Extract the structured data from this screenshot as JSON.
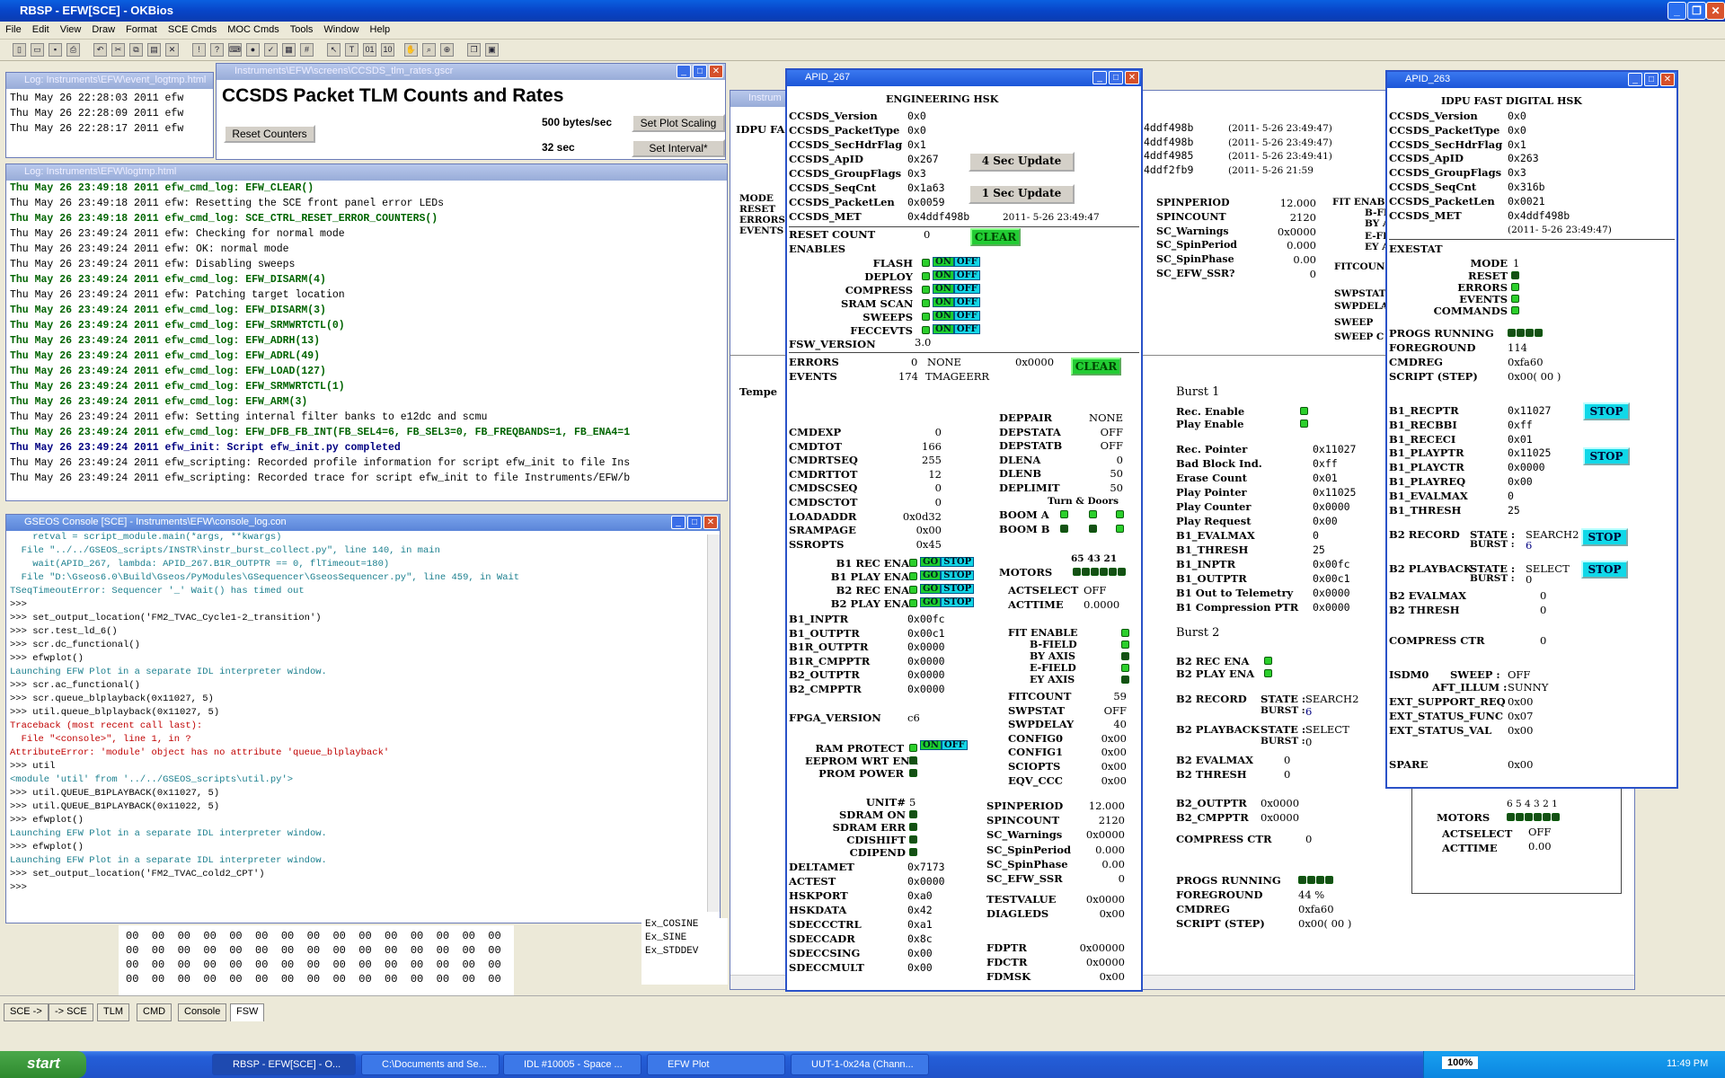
{
  "app": {
    "title": "RBSP - EFW[SCE] - OKBios"
  },
  "menu": [
    "File",
    "Edit",
    "View",
    "Draw",
    "Format",
    "SCE Cmds",
    "MOC Cmds",
    "Tools",
    "Window",
    "Help"
  ],
  "eventlog": {
    "title": "Log: Instruments\\EFW\\event_logtmp.html",
    "lines": [
      "Thu May 26 22:28:03 2011 efw",
      "Thu May 26 22:28:09 2011 efw",
      "Thu May 26 22:28:17 2011 efw"
    ]
  },
  "rates": {
    "title": "Instruments\\EFW\\screens\\CCSDS_tlm_rates.gscr",
    "heading": "CCSDS Packet TLM Counts and Rates",
    "reset": "Reset Counters",
    "rate": "500 bytes/sec",
    "interval": "32 sec",
    "scaling": "Set Plot Scaling",
    "setint": "Set Interval*"
  },
  "logtmp": {
    "title": "Log: Instruments\\EFW\\logtmp.html",
    "lines": [
      [
        "g",
        "Thu May 26 23:49:18 2011 efw_cmd_log: EFW_CLEAR()"
      ],
      [
        "n",
        "Thu May 26 23:49:18 2011 efw: Resetting the SCE front panel error LEDs"
      ],
      [
        "g",
        "Thu May 26 23:49:18 2011 efw_cmd_log: SCE_CTRL_RESET_ERROR_COUNTERS()"
      ],
      [
        "n",
        "Thu May 26 23:49:24 2011 efw: Checking for normal mode"
      ],
      [
        "n",
        "Thu May 26 23:49:24 2011 efw: OK: normal mode"
      ],
      [
        "n",
        "Thu May 26 23:49:24 2011 efw: Disabling sweeps"
      ],
      [
        "g",
        "Thu May 26 23:49:24 2011 efw_cmd_log: EFW_DISARM(4)"
      ],
      [
        "n",
        "Thu May 26 23:49:24 2011 efw: Patching target location"
      ],
      [
        "g",
        "Thu May 26 23:49:24 2011 efw_cmd_log: EFW_DISARM(3)"
      ],
      [
        "g",
        "Thu May 26 23:49:24 2011 efw_cmd_log: EFW_SRMWRTCTL(0)"
      ],
      [
        "g",
        "Thu May 26 23:49:24 2011 efw_cmd_log: EFW_ADRH(13)"
      ],
      [
        "g",
        "Thu May 26 23:49:24 2011 efw_cmd_log: EFW_ADRL(49)"
      ],
      [
        "g",
        "Thu May 26 23:49:24 2011 efw_cmd_log: EFW_LOAD(127)"
      ],
      [
        "g",
        "Thu May 26 23:49:24 2011 efw_cmd_log: EFW_SRMWRTCTL(1)"
      ],
      [
        "g",
        "Thu May 26 23:49:24 2011 efw_cmd_log: EFW_ARM(3)"
      ],
      [
        "n",
        "Thu May 26 23:49:24 2011 efw: Setting internal filter banks to e12dc and scmu"
      ],
      [
        "g",
        "Thu May 26 23:49:24 2011 efw_cmd_log: EFW_DFB_FB_INT(FB_SEL4=6, FB_SEL3=0, FB_FREQBANDS=1, FB_ENA4=1"
      ],
      [
        "b",
        "Thu May 26 23:49:24 2011 efw_init: Script efw_init.py completed"
      ],
      [
        "n",
        "Thu May 26 23:49:24 2011 efw_scripting: Recorded profile information for script efw_init to file Ins"
      ],
      [
        "n",
        "Thu May 26 23:49:24 2011 efw_scripting: Recorded trace for script efw_init to file Instruments/EFW/b"
      ]
    ]
  },
  "console": {
    "title": "GSEOS Console  [SCE] - Instruments\\EFW\\console_log.con",
    "lines": [
      [
        "t",
        "    retval = script_module.main(*args, **kwargs)"
      ],
      [
        "t",
        "  File \"../../GSEOS_scripts/INSTR\\instr_burst_collect.py\", line 140, in main"
      ],
      [
        "t",
        "    wait(APID_267, lambda: APID_267.B1R_OUTPTR == 0, flTimeout=180)"
      ],
      [
        "t",
        "  File \"D:\\Gseos6.0\\Build\\Gseos/PyModules\\GSequencer\\GseosSequencer.py\", line 459, in Wait"
      ],
      [
        "t",
        "TSeqTimeoutError: Sequencer '_' Wait() has timed out"
      ],
      [
        "k",
        ">>>"
      ],
      [
        "k",
        ">>> set_output_location('FM2_TVAC_Cycle1-2_transition')"
      ],
      [
        "k",
        ">>> scr.test_ld_6()"
      ],
      [
        "k",
        ">>> scr.dc_functional()"
      ],
      [
        "k",
        ">>> efwplot()"
      ],
      [
        "t",
        "Launching EFW Plot in a separate IDL interpreter window."
      ],
      [
        "k",
        ">>> scr.ac_functional()"
      ],
      [
        "k",
        ">>> scr.queue_blplayback(0x11027, 5)"
      ],
      [
        "k",
        ">>> util.queue_blplayback(0x11027, 5)"
      ],
      [
        "r",
        "Traceback (most recent call last):"
      ],
      [
        "r",
        "  File \"<console>\", line 1, in ?"
      ],
      [
        "r",
        "AttributeError: 'module' object has no attribute 'queue_blplayback'"
      ],
      [
        "k",
        ">>> util"
      ],
      [
        "t",
        "<module 'util' from '../../GSEOS_scripts\\util.py'>"
      ],
      [
        "k",
        ">>> util.QUEUE_B1PLAYBACK(0x11027, 5)"
      ],
      [
        "k",
        ">>> util.QUEUE_B1PLAYBACK(0x11022, 5)"
      ],
      [
        "k",
        ">>> efwplot()"
      ],
      [
        "t",
        "Launching EFW Plot in a separate IDL interpreter window."
      ],
      [
        "k",
        ">>> efwplot()"
      ],
      [
        "t",
        "Launching EFW Plot in a separate IDL interpreter window."
      ],
      [
        "k",
        ">>> set_output_location('FM2_TVAC_cold2_CPT')"
      ],
      [
        "k",
        ">>>"
      ]
    ]
  },
  "hexgrid": [
    "00  00  00  00  00  00  00  00  00  00  00  00  00  00  00  00",
    "00  00  00  00  00  00  00  00  00  00  00  00  00  00  00  00",
    "00  00  00  00  00  00  00  00  00  00  00  00  00  00  00  00",
    "00  00  00  00  00  00  00  00  00  00  00  00  00  00  00  00"
  ],
  "exlist": [
    "Ex_COSINE",
    "Ex_SINE",
    "Ex_STDDEV"
  ],
  "bg": {
    "title": "Instrum",
    "idpu": "IDPU FA",
    "mode": "MODE",
    "reset": "RESET",
    "errors": "ERRORS",
    "events": "EVENTS",
    "temp": "Tempe",
    "met": [
      [
        "4ddf498b",
        "(2011- 5-26  23:49:47)"
      ],
      [
        "4ddf498b",
        "(2011- 5-26  23:49:47)"
      ],
      [
        "4ddf4985",
        "(2011- 5-26  23:49:41)"
      ],
      [
        "4ddf2fb9",
        "(2011- 5-26  21:59"
      ]
    ],
    "spin": [
      [
        "SPINPERIOD",
        "12.000"
      ],
      [
        "SPINCOUNT",
        "2120"
      ],
      [
        "SC_Warnings",
        "0x0000"
      ],
      [
        "SC_SpinPeriod",
        "0.000"
      ],
      [
        "SC_SpinPhase",
        "0.00"
      ],
      [
        "SC_EFW_SSR?",
        "0"
      ]
    ],
    "fitlabels": [
      "FIT ENAB",
      "B-FI",
      "BY A",
      "E-FI",
      "EY A",
      "FITCOUN",
      "SWPSTAT",
      "SWPDELA",
      "SWEEP",
      "SWEEP C"
    ],
    "burst1": {
      "title": "Burst 1",
      "recena": "Rec. Enable",
      "playena": "Play Enable",
      "rows": [
        [
          "Rec. Pointer",
          "0x11027"
        ],
        [
          "Bad Block Ind.",
          "0xff"
        ],
        [
          "Erase Count",
          "0x01"
        ],
        [
          "Play Pointer",
          "0x11025"
        ],
        [
          "Play Counter",
          "0x0000"
        ],
        [
          "Play Request",
          "0x00"
        ],
        [
          "B1_EVALMAX",
          "0"
        ],
        [
          "B1_THRESH",
          "25"
        ],
        [
          "B1_INPTR",
          "0x00fc"
        ],
        [
          "B1_OUTPTR",
          "0x00c1"
        ],
        [
          "B1 Out to Telemetry",
          "0x0000"
        ],
        [
          "B1 Compression PTR",
          "0x0000"
        ]
      ]
    },
    "burst2": {
      "title": "Burst 2",
      "recena": "B2 REC ENA",
      "playena": "B2 PLAY ENA",
      "record": "B2 RECORD",
      "playback": "B2 PLAYBACK",
      "state": "STATE :",
      "burst": "BURST :",
      "rstate": "SEARCH2",
      "rburst": "6",
      "pstate": "SELECT",
      "pburst": "0",
      "evalmax": "B2 EVALMAX",
      "thresh": "B2 THRESH",
      "evalv": "0",
      "threshv": "0",
      "outptr": "B2_OUTPTR",
      "cmpptr": "B2_CMPPTR",
      "outv": "0x0000",
      "cmpv": "0x0000",
      "compress": "COMPRESS CTR",
      "compv": "0"
    },
    "progs": {
      "running": "PROGS RUNNING",
      "foreground": "FOREGROUND",
      "fgv": "44 %",
      "cmdreg": "CMDREG",
      "cmdv": "0xfa60",
      "script": "SCRIPT (STEP)",
      "scriptv": "0x00( 00 )"
    },
    "motors": {
      "nums": "6 5 4 3 2 1",
      "label": "MOTORS",
      "actselect": "ACTSELECT",
      "actselv": "OFF",
      "acttime": "ACTTIME",
      "acttimev": "0.00"
    }
  },
  "apid267": {
    "title": "APID_267",
    "heading": "ENGINEERING HSK",
    "ccsds": [
      [
        "CCSDS_Version",
        "0x0"
      ],
      [
        "CCSDS_PacketType",
        "0x0"
      ],
      [
        "CCSDS_SecHdrFlag",
        "0x1"
      ],
      [
        "CCSDS_ApID",
        "0x267"
      ],
      [
        "CCSDS_GroupFlags",
        "0x3"
      ],
      [
        "CCSDS_SeqCnt",
        "0x1a63"
      ],
      [
        "CCSDS_PacketLen",
        "0x0059"
      ],
      [
        "CCSDS_MET",
        "0x4ddf498b"
      ]
    ],
    "upd4": "4 Sec Update",
    "upd1": "1 Sec Update",
    "metdate": "2011- 5-26  23:49:47",
    "resetcount": "RESET COUNT",
    "resetv": "0",
    "clear": "CLEAR",
    "enables": "ENABLES",
    "enablist": [
      "FLASH",
      "DEPLOY",
      "COMPRESS",
      "SRAM SCAN",
      "SWEEPS",
      "FECCEVTS"
    ],
    "on": "ON",
    "off": "OFF",
    "fswv": "FSW_VERSION",
    "fswvv": "3.0",
    "errors": "ERRORS",
    "errv": "0",
    "errname": "NONE",
    "errhex": "0x0000",
    "events": "EVENTS",
    "evv": "174",
    "evname": "TMAGEERR",
    "left": [
      [
        "CMDEXP",
        "0"
      ],
      [
        "CMDTOT",
        "166"
      ],
      [
        "CMDRTSEQ",
        "255"
      ],
      [
        "CMDRTTOT",
        "12"
      ],
      [
        "CMDSCSEQ",
        "0"
      ],
      [
        "CMDSCTOT",
        "0"
      ],
      [
        "LOADADDR",
        "0x0d32"
      ],
      [
        "SRAMPAGE",
        "0x00"
      ],
      [
        "SSROPTS",
        "0x45"
      ]
    ],
    "deppair": [
      [
        "DEPPAIR",
        "NONE"
      ],
      [
        "DEPSTATA",
        "OFF"
      ],
      [
        "DEPSTATB",
        "OFF"
      ],
      [
        "DLENA",
        "0"
      ],
      [
        "DLENB",
        "50"
      ],
      [
        "DEPLIMIT",
        "50"
      ]
    ],
    "turndoors": "Turn & Doors",
    "booma": "BOOM A",
    "boomb": "BOOM B",
    "recplay": [
      "B1 REC ENA",
      "B1 PLAY ENA",
      "B2 REC ENA",
      "B2 PLAY ENA"
    ],
    "go": "GO",
    "stop": "STOP",
    "motors": "MOTORS",
    "motornums": "65 43 21",
    "actselect": "ACTSELECT",
    "actselv": "OFF",
    "acttime": "ACTTIME",
    "acttimev": "0.0000",
    "ptrs": [
      [
        "B1_INPTR",
        "0x00fc"
      ],
      [
        "B1_OUTPTR",
        "0x00c1"
      ],
      [
        "B1R_OUTPTR",
        "0x0000"
      ],
      [
        "B1R_CMPPTR",
        "0x0000"
      ],
      [
        "B2_OUTPTR",
        "0x0000"
      ],
      [
        "B2_CMPPTR",
        "0x0000"
      ]
    ],
    "fit": [
      "FIT ENABLE",
      "B-FIELD",
      "BY AXIS",
      "E-FIELD",
      "EY AXIS"
    ],
    "fitcount": [
      [
        "FITCOUNT",
        "59"
      ],
      [
        "SWPSTAT",
        "OFF"
      ],
      [
        "SWPDELAY",
        "40"
      ],
      [
        "CONFIG0",
        "0x00"
      ],
      [
        "CONFIG1",
        "0x00"
      ],
      [
        "SCIOPTS",
        "0x00"
      ],
      [
        "EQV_CCC",
        "0x00"
      ]
    ],
    "fpga": "FPGA_VERSION",
    "fpgav": "c6",
    "ramprot": "RAM PROTECT",
    "eeprom": "EEPROM WRT ENA",
    "prompow": "PROM POWER",
    "unit": "UNIT#",
    "unitv": "5",
    "sdram": [
      "SDRAM ON",
      "SDRAM ERR",
      "CDISHIFT",
      "CDIPEND"
    ],
    "spin": [
      [
        "SPINPERIOD",
        "12.000"
      ],
      [
        "SPINCOUNT",
        "2120"
      ],
      [
        "SC_Warnings",
        "0x0000"
      ],
      [
        "SC_SpinPeriod",
        "0.000"
      ],
      [
        "SC_SpinPhase",
        "0.00"
      ],
      [
        "SC_EFW_SSR",
        "0"
      ]
    ],
    "bottom": [
      [
        "DELTAMET",
        "0x7173"
      ],
      [
        "ACTEST",
        "0x0000"
      ],
      [
        "HSKPORT",
        "0xa0"
      ],
      [
        "HSKDATA",
        "0x42"
      ],
      [
        "SDECCCTRL",
        "0xa1"
      ],
      [
        "SDECCADR",
        "0x8c"
      ],
      [
        "SDECCSING",
        "0x00"
      ],
      [
        "SDECCMULT",
        "0x00"
      ]
    ],
    "test": [
      [
        "TESTVALUE",
        "0x0000"
      ],
      [
        "DIAGLEDS",
        "0x00"
      ]
    ],
    "fd": [
      [
        "FDPTR",
        "0x00000"
      ],
      [
        "FDCTR",
        "0x0000"
      ],
      [
        "FDMSK",
        "0x00"
      ]
    ]
  },
  "apid263": {
    "title": "APID_263",
    "heading": "IDPU FAST DIGITAL HSK",
    "ccsds": [
      [
        "CCSDS_Version",
        "0x0"
      ],
      [
        "CCSDS_PacketType",
        "0x0"
      ],
      [
        "CCSDS_SecHdrFlag",
        "0x1"
      ],
      [
        "CCSDS_ApID",
        "0x263"
      ],
      [
        "CCSDS_GroupFlags",
        "0x3"
      ],
      [
        "CCSDS_SeqCnt",
        "0x316b"
      ],
      [
        "CCSDS_PacketLen",
        "0x0021"
      ],
      [
        "CCSDS_MET",
        "0x4ddf498b"
      ]
    ],
    "metdate": "(2011- 5-26  23:49:47)",
    "exestat": "EXESTAT",
    "mode": "MODE",
    "modev": "1",
    "stat": [
      "RESET",
      "ERRORS",
      "EVENTS",
      "COMMANDS"
    ],
    "progs": "PROGS RUNNING",
    "fg": "FOREGROUND",
    "fgv": "114",
    "cmdreg": "CMDREG",
    "cmdv": "0xfa60",
    "script": "SCRIPT (STEP)",
    "scriptv": "0x00( 00 )",
    "b1": [
      [
        "B1_RECPTR",
        "0x11027"
      ],
      [
        "B1_RECBBI",
        "0xff"
      ],
      [
        "B1_RECECI",
        "0x01"
      ],
      [
        "B1_PLAYPTR",
        "0x11025"
      ],
      [
        "B1_PLAYCTR",
        "0x0000"
      ],
      [
        "B1_PLAYREQ",
        "0x00"
      ],
      [
        "B1_EVALMAX",
        "0"
      ],
      [
        "B1_THRESH",
        "25"
      ]
    ],
    "stop": "STOP",
    "b2rec": "B2 RECORD",
    "b2play": "B2 PLAYBACK",
    "state": "STATE :",
    "burst": "BURST :",
    "rstate": "SEARCH2",
    "rburst": "6",
    "pstate": "SELECT",
    "pburst": "0",
    "b2eval": "B2 EVALMAX",
    "b2thr": "B2 THRESH",
    "b2evalv": "0",
    "b2thrv": "0",
    "compress": "COMPRESS CTR",
    "compv": "0",
    "isdm": "ISDM0",
    "sweep": "SWEEP :",
    "sweepv": "OFF",
    "aft": "AFT_ILLUM :",
    "aftv": "SUNNY",
    "ext": [
      [
        "EXT_SUPPORT_REQ",
        "0x00"
      ],
      [
        "EXT_STATUS_FUNC",
        "0x07"
      ],
      [
        "EXT_STATUS_VAL",
        "0x00"
      ]
    ],
    "spare": "SPARE",
    "sparev": "0x00"
  },
  "tabs": [
    "SCE ->",
    "-> SCE",
    "TLM",
    "CMD",
    "Console",
    "FSW"
  ],
  "taskbar": {
    "start": "start",
    "tasks": [
      "RBSP - EFW[SCE] - O...",
      "C:\\Documents and Se...",
      "IDL #10005 - Space ...",
      "EFW Plot",
      "UUT-1-0x24a (Chann..."
    ],
    "zoom": "100%",
    "time": "11:49 PM"
  }
}
